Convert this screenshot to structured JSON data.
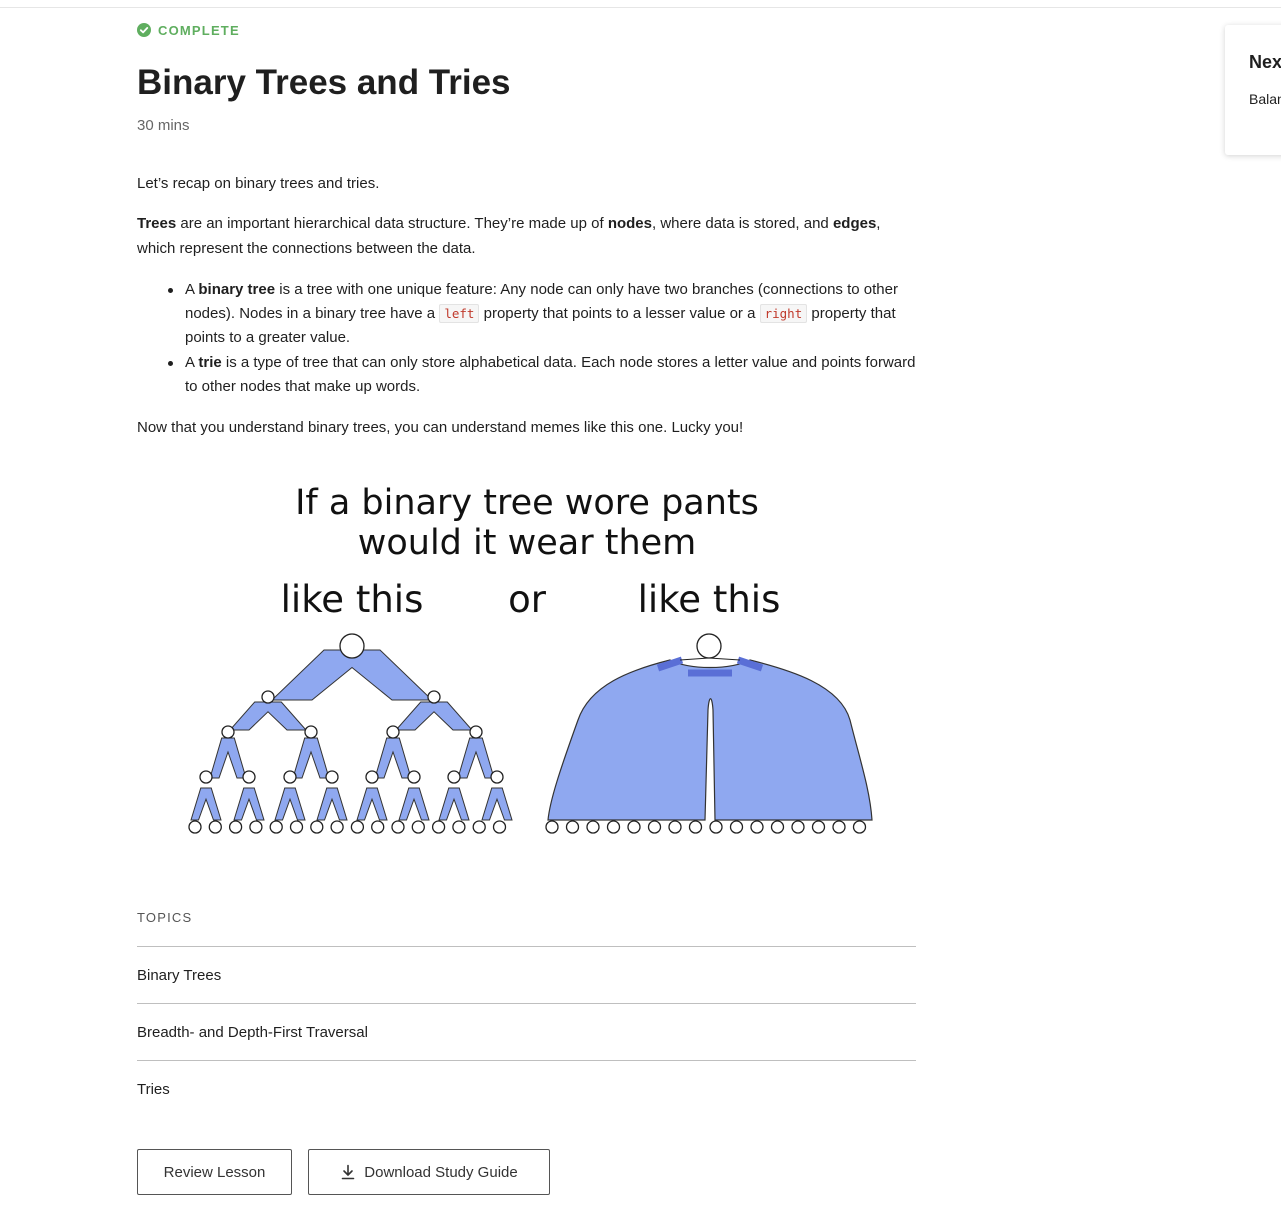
{
  "status": {
    "label": "COMPLETE",
    "color": "#5fae5f"
  },
  "lesson": {
    "title": "Binary Trees and Tries",
    "duration": "30 mins"
  },
  "content": {
    "intro": "Let’s recap on binary trees and tries.",
    "trees_para": {
      "t1": "Trees",
      "t2": " are an important hierarchical data structure. They’re made up of ",
      "t3": "nodes",
      "t4": ", where data is stored, and ",
      "t5": "edges",
      "t6": ", which represent the connections between the data."
    },
    "bullets": [
      {
        "a": "A ",
        "term": "binary tree",
        "b": " is a tree with one unique feature: Any node can only have two branches (connections to other nodes). Nodes in a binary tree have a ",
        "code1": "left",
        "c": " property that points to a lesser value or a ",
        "code2": "right",
        "d": " property that points to a greater value."
      },
      {
        "a": "A ",
        "term": "trie",
        "b": " is a type of tree that can only store alphabetical data. Each node stores a letter value and points forward to other nodes that make up words."
      }
    ],
    "meme_intro": "Now that you understand binary trees, you can understand memes like this one. Lucky you!",
    "meme": {
      "line1": "If a binary tree wore pants",
      "line2": "would it wear them",
      "left_label": "like this",
      "middle_label": "or",
      "right_label": "like this",
      "pants_color": "#8fa8f0",
      "accent_color": "#5a6fd6"
    }
  },
  "topics": {
    "heading": "TOPICS",
    "items": [
      "Binary Trees",
      "Breadth- and Depth-First Traversal",
      "Tries"
    ]
  },
  "actions": {
    "review": "Review Lesson",
    "download": "Download Study Guide"
  },
  "sidebar": {
    "heading": "Nex",
    "link": "Balanced Tree"
  }
}
